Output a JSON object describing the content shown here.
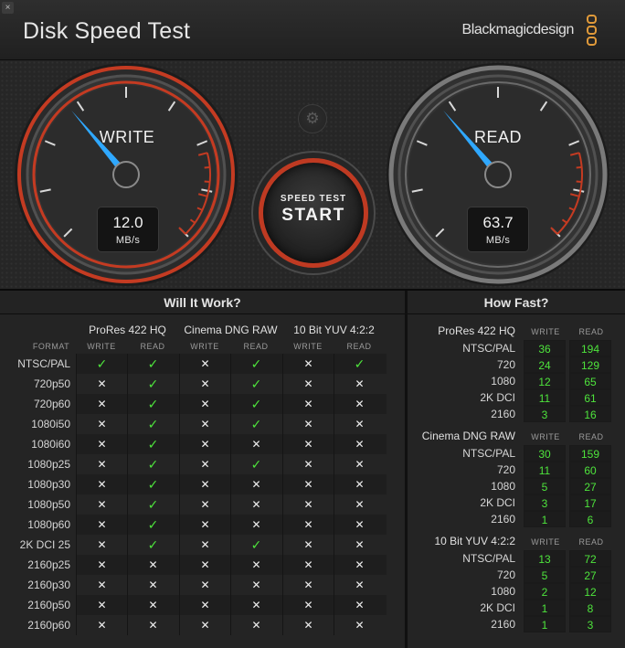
{
  "window": {
    "title": "Disk Speed Test",
    "brand": "Blackmagicdesign",
    "close_glyph": "×"
  },
  "gauges": {
    "write": {
      "label": "WRITE",
      "value": "12.0",
      "unit": "MB/s",
      "needle_level": 0.35
    },
    "read": {
      "label": "READ",
      "value": "63.7",
      "unit": "MB/s",
      "needle_level": 0.35
    }
  },
  "buttons": {
    "settings_icon": "gear-icon",
    "start_small": "SPEED TEST",
    "start_big": "START"
  },
  "colors": {
    "accent_red": "#c43b22",
    "ok_green": "#4ee43c",
    "needle_blue": "#2fa8ff",
    "logo_orange": "#e09a3a"
  },
  "will_it_work": {
    "title": "Will It Work?",
    "format_label": "FORMAT",
    "write_label": "WRITE",
    "read_label": "READ",
    "groups": [
      "ProRes 422 HQ",
      "Cinema DNG RAW",
      "10 Bit YUV 4:2:2"
    ],
    "rows": [
      {
        "format": "NTSC/PAL",
        "cells": [
          1,
          1,
          0,
          1,
          0,
          1
        ]
      },
      {
        "format": "720p50",
        "cells": [
          0,
          1,
          0,
          1,
          0,
          0
        ]
      },
      {
        "format": "720p60",
        "cells": [
          0,
          1,
          0,
          1,
          0,
          0
        ]
      },
      {
        "format": "1080i50",
        "cells": [
          0,
          1,
          0,
          1,
          0,
          0
        ]
      },
      {
        "format": "1080i60",
        "cells": [
          0,
          1,
          0,
          0,
          0,
          0
        ]
      },
      {
        "format": "1080p25",
        "cells": [
          0,
          1,
          0,
          1,
          0,
          0
        ]
      },
      {
        "format": "1080p30",
        "cells": [
          0,
          1,
          0,
          0,
          0,
          0
        ]
      },
      {
        "format": "1080p50",
        "cells": [
          0,
          1,
          0,
          0,
          0,
          0
        ]
      },
      {
        "format": "1080p60",
        "cells": [
          0,
          1,
          0,
          0,
          0,
          0
        ]
      },
      {
        "format": "2K DCI 25",
        "cells": [
          0,
          1,
          0,
          1,
          0,
          0
        ]
      },
      {
        "format": "2160p25",
        "cells": [
          0,
          0,
          0,
          0,
          0,
          0
        ]
      },
      {
        "format": "2160p30",
        "cells": [
          0,
          0,
          0,
          0,
          0,
          0
        ]
      },
      {
        "format": "2160p50",
        "cells": [
          0,
          0,
          0,
          0,
          0,
          0
        ]
      },
      {
        "format": "2160p60",
        "cells": [
          0,
          0,
          0,
          0,
          0,
          0
        ]
      }
    ]
  },
  "how_fast": {
    "title": "How Fast?",
    "write_label": "WRITE",
    "read_label": "READ",
    "groups": [
      {
        "name": "ProRes 422 HQ",
        "rows": [
          {
            "format": "NTSC/PAL",
            "write": "36",
            "read": "194"
          },
          {
            "format": "720",
            "write": "24",
            "read": "129"
          },
          {
            "format": "1080",
            "write": "12",
            "read": "65"
          },
          {
            "format": "2K DCI",
            "write": "11",
            "read": "61"
          },
          {
            "format": "2160",
            "write": "3",
            "read": "16"
          }
        ]
      },
      {
        "name": "Cinema DNG RAW",
        "rows": [
          {
            "format": "NTSC/PAL",
            "write": "30",
            "read": "159"
          },
          {
            "format": "720",
            "write": "11",
            "read": "60"
          },
          {
            "format": "1080",
            "write": "5",
            "read": "27"
          },
          {
            "format": "2K DCI",
            "write": "3",
            "read": "17"
          },
          {
            "format": "2160",
            "write": "1",
            "read": "6"
          }
        ]
      },
      {
        "name": "10 Bit YUV 4:2:2",
        "rows": [
          {
            "format": "NTSC/PAL",
            "write": "13",
            "read": "72"
          },
          {
            "format": "720",
            "write": "5",
            "read": "27"
          },
          {
            "format": "1080",
            "write": "2",
            "read": "12"
          },
          {
            "format": "2K DCI",
            "write": "1",
            "read": "8"
          },
          {
            "format": "2160",
            "write": "1",
            "read": "3"
          }
        ]
      }
    ]
  }
}
